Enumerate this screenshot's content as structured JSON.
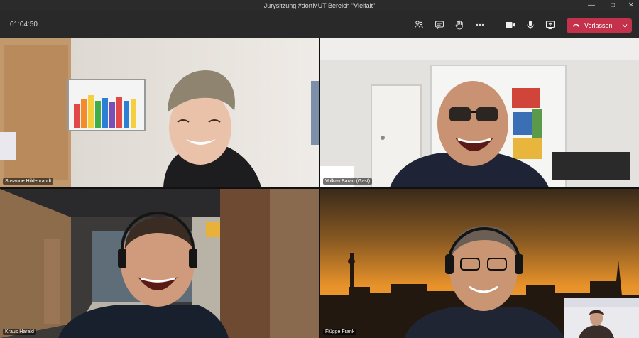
{
  "window": {
    "title": "Jurysitzung #dortMUT Bereich \"Vielfalt\""
  },
  "toolbar": {
    "timer": "01:04:50",
    "icons": [
      "people-icon",
      "chat-icon",
      "raise-hand-icon",
      "more-icon",
      "camera-icon",
      "mic-icon",
      "share-screen-icon"
    ],
    "leave_label": "Verlassen"
  },
  "participants": [
    {
      "name": "Susanne Hildebrandt"
    },
    {
      "name": "Volkan Baran (Gast)"
    },
    {
      "name": "Kraus Harald"
    },
    {
      "name": "Flügge Frank"
    }
  ],
  "colors": {
    "leave": "#c4314b",
    "titlebar": "#2b2b2b",
    "toolbar": "#292929"
  }
}
